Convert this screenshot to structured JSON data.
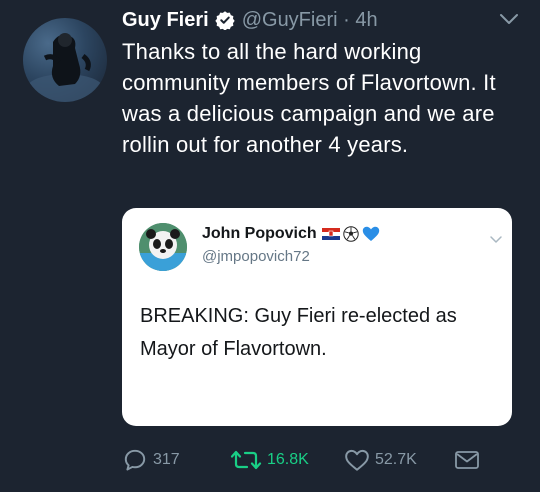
{
  "tweet": {
    "author_name": "Guy Fieri",
    "handle_time": "@GuyFieri · 4h",
    "text": "Thanks to all the hard working community members of Flavortown. It was a delicious campaign and we are rollin out for another 4 years."
  },
  "quoted": {
    "author_name": "John Popovich",
    "handle": "@jmpopovich72",
    "text": "BREAKING: Guy Fieri re-elected as Mayor of Flavortown."
  },
  "actions": {
    "replies": "317",
    "retweets": "16.8K",
    "likes": "52.7K"
  },
  "colors": {
    "background": "#1c2430",
    "muted": "#8899a6",
    "retweet_green": "#19cf86",
    "verified_blue": "#1da1f2"
  },
  "icons": [
    "verified-badge-icon",
    "chevron-down-icon",
    "croatia-flag-icon",
    "soccer-ball-icon",
    "blue-heart-icon",
    "reply-icon",
    "retweet-icon",
    "like-icon",
    "direct-message-icon"
  ]
}
